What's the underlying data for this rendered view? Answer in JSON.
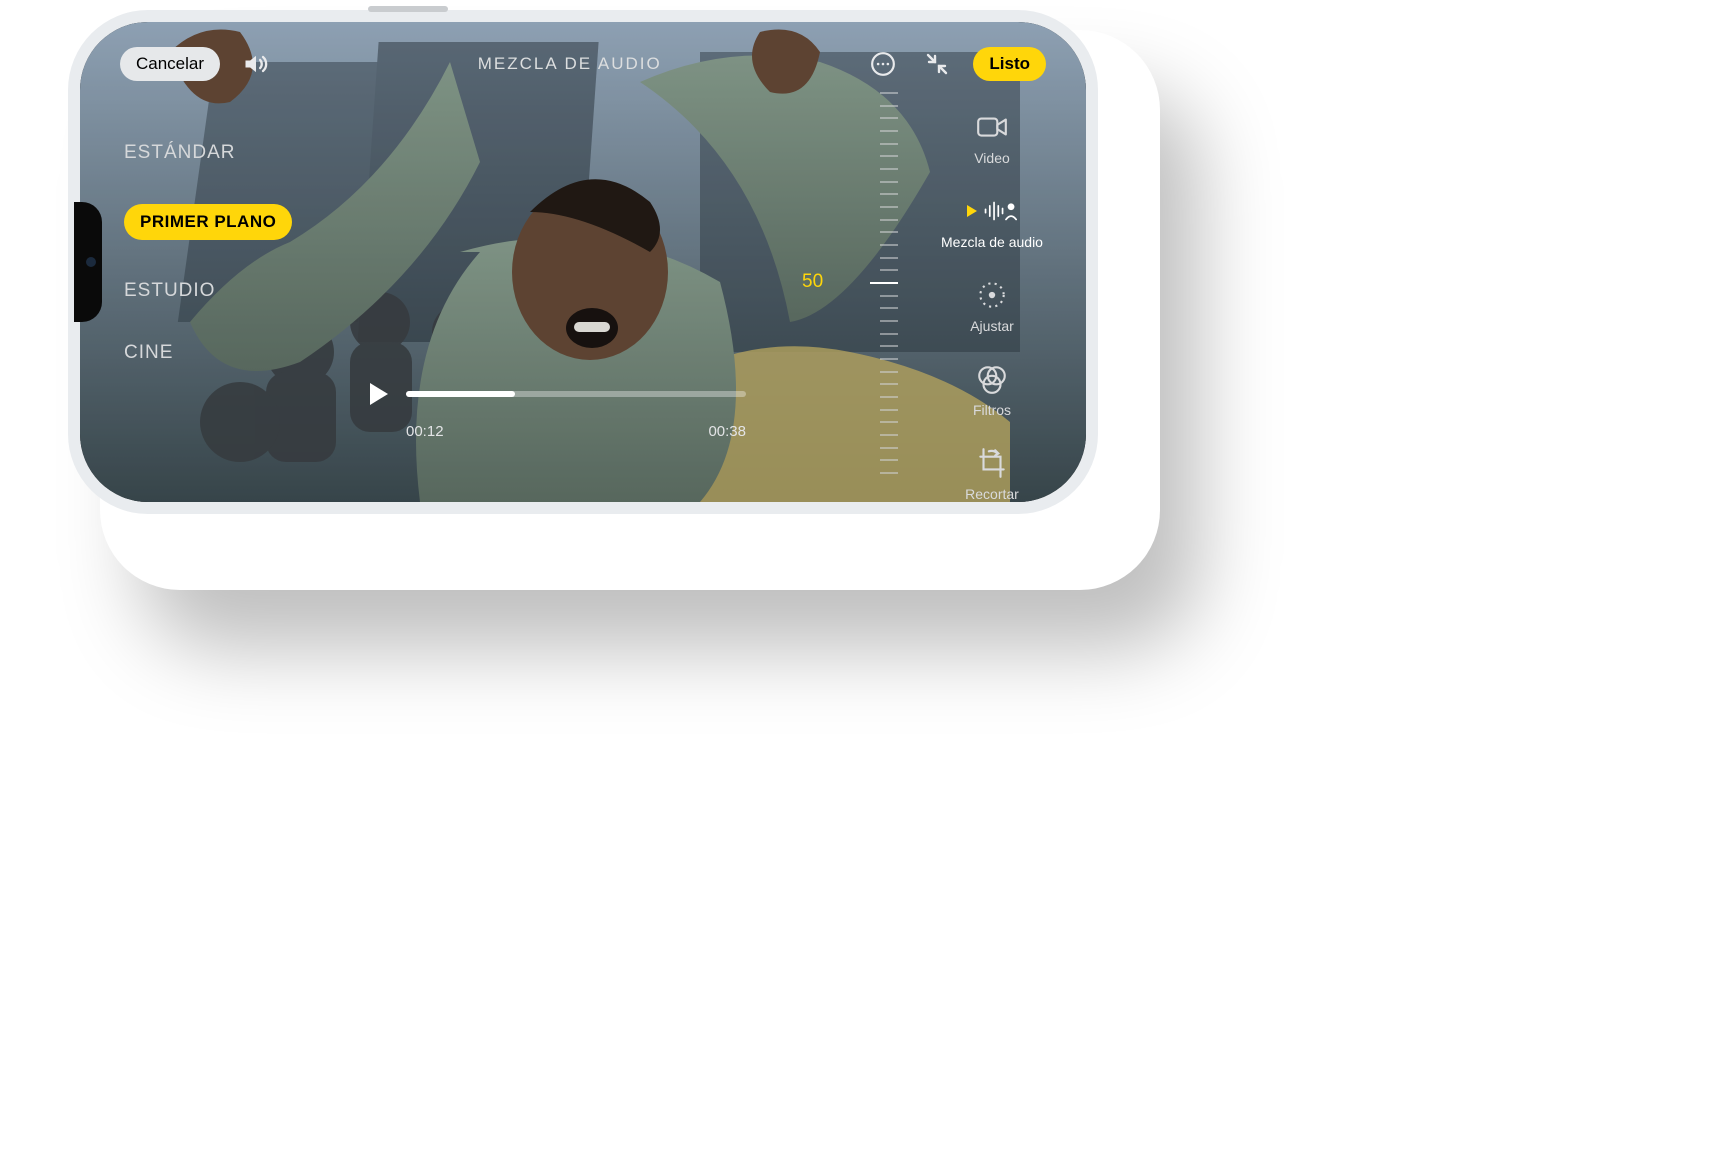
{
  "header": {
    "cancel": "Cancelar",
    "title": "MEZCLA DE AUDIO",
    "done": "Listo"
  },
  "modes": {
    "items": [
      {
        "label": "ESTÁNDAR",
        "selected": false
      },
      {
        "label": "PRIMER PLANO",
        "selected": true
      },
      {
        "label": "ESTUDIO",
        "selected": false
      },
      {
        "label": "CINE",
        "selected": false
      }
    ]
  },
  "slider": {
    "value": "50"
  },
  "playback": {
    "current": "00:12",
    "total": "00:38",
    "progress_pct": 32
  },
  "tools": {
    "items": [
      {
        "key": "video",
        "label": "Video",
        "active": false
      },
      {
        "key": "audio-mix",
        "label": "Mezcla de audio",
        "active": true
      },
      {
        "key": "adjust",
        "label": "Ajustar",
        "active": false
      },
      {
        "key": "filters",
        "label": "Filtros",
        "active": false
      },
      {
        "key": "crop",
        "label": "Recortar",
        "active": false
      }
    ]
  },
  "colors": {
    "accent": "#ffd60a"
  }
}
